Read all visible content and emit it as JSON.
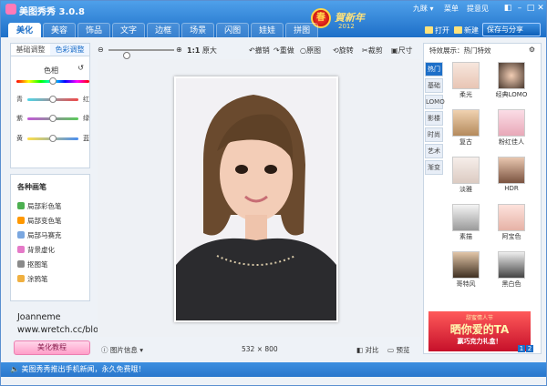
{
  "app": {
    "title": "美图秀秀 3.0.8"
  },
  "topbar": {
    "user": "九眯 ▾",
    "menu": "菜单",
    "feedback": "提意见"
  },
  "tabs": [
    "美化",
    "美容",
    "饰品",
    "文字",
    "边框",
    "场景",
    "闪图",
    "娃娃",
    "拼图"
  ],
  "deco": {
    "glyph": "春",
    "text": "賀新年",
    "year": "2012"
  },
  "actions": {
    "open": "打开",
    "new": "新建",
    "save": "保存与分享"
  },
  "left": {
    "tabs": [
      "基础调整",
      "色彩调整"
    ],
    "hue_label": "色相",
    "sliders": [
      {
        "left": "青",
        "right": "红",
        "value": 0.5
      },
      {
        "left": "紫",
        "right": "绿",
        "value": 0.5
      },
      {
        "left": "黄",
        "right": "蓝",
        "value": 0.5
      }
    ],
    "tools_title": "各种画笔",
    "tools": [
      "局部彩色笔",
      "局部变色笔",
      "局部马赛克",
      "背景虚化",
      "抠图笔",
      "涂鸦笔"
    ]
  },
  "credit": {
    "name": "Joanneme",
    "url": "www.wretch.cc/blog/joanneme"
  },
  "tutorial": {
    "label": "美化教程"
  },
  "toolbar": {
    "ratio": "1:1",
    "original": "原大",
    "undo": "撤销",
    "redo": "重做",
    "orig_img": "原图",
    "rotate": "旋转",
    "crop": "裁剪",
    "size": "尺寸"
  },
  "status": {
    "image_info": "图片信息",
    "dims": "532 × 800",
    "compare": "对比",
    "preview": "预览"
  },
  "right": {
    "header": "特效展示：热门特效",
    "categories": [
      "热门",
      "基础",
      "LOMO",
      "影楼",
      "时尚",
      "艺术",
      "渐变"
    ],
    "effects": [
      "柔光",
      "经典LOMO",
      "复古",
      "粉红佳人",
      "淡雅",
      "HDR",
      "素描",
      "阿宝色",
      "哥特风",
      "黑白色"
    ]
  },
  "ad": {
    "line1": "甜蜜情人节",
    "line2": "晒你爱的TA",
    "line3": "赢巧克力礼盒！"
  },
  "pager": [
    "1",
    "2"
  ],
  "bottom": {
    "message": "美图秀秀推出手机新闻，永久免费哦！"
  }
}
